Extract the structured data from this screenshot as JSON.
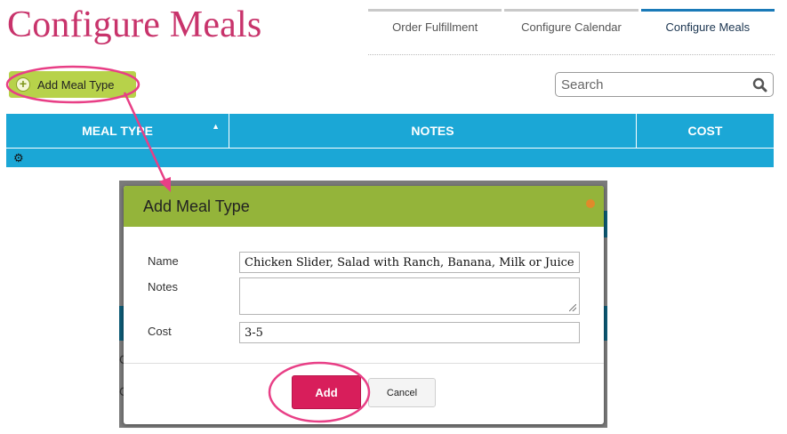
{
  "page": {
    "title": "Configure Meals"
  },
  "tabs": [
    {
      "label": "Order Fulfillment",
      "active": false
    },
    {
      "label": "Configure Calendar",
      "active": false
    },
    {
      "label": "Configure Meals",
      "active": true
    }
  ],
  "toolbar": {
    "add_label": "Add Meal Type",
    "add_icon": "plus-icon"
  },
  "search": {
    "placeholder": "Search",
    "icon": "search-icon"
  },
  "table": {
    "columns": [
      "MEAL TYPE",
      "NOTES",
      "COST"
    ],
    "sort_column": "MEAL TYPE",
    "sort_direction": "ascending",
    "row_icon": "gear-icon"
  },
  "modal": {
    "title": "Add Meal Type",
    "fields": {
      "name": {
        "label": "Name",
        "value": "Chicken Slider, Salad with Ranch, Banana, Milk or Juice"
      },
      "notes": {
        "label": "Notes",
        "value": ""
      },
      "cost": {
        "label": "Cost",
        "value": "3-5"
      }
    },
    "buttons": {
      "submit": "Add",
      "cancel": "Cancel"
    }
  },
  "colors": {
    "title": "#c8336b",
    "table_header": "#1ba7d6",
    "modal_header": "#94b43a",
    "primary_button": "#d81e5b",
    "add_button": "#b7d24a",
    "annotation": "#e83f86"
  }
}
